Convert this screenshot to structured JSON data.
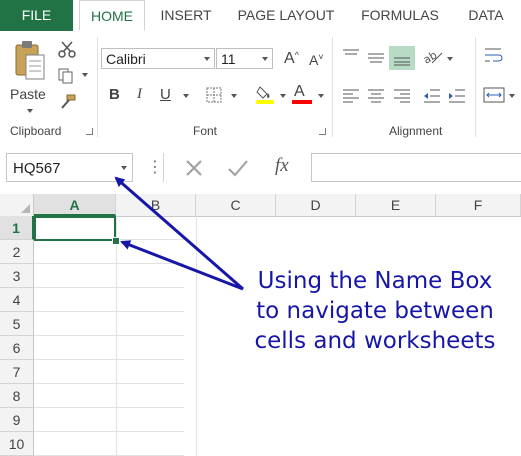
{
  "tabs": {
    "file": "FILE",
    "home": "HOME",
    "insert": "INSERT",
    "page_layout": "PAGE LAYOUT",
    "formulas": "FORMULAS",
    "data": "DATA"
  },
  "ribbon": {
    "clipboard": {
      "paste_label": "Paste",
      "group_label": "Clipboard"
    },
    "font": {
      "font_name": "Calibri",
      "font_size": "11",
      "bold": "B",
      "italic": "I",
      "underline": "U",
      "group_label": "Font",
      "fill_color": "#ffff00",
      "font_color": "#ff0000"
    },
    "alignment": {
      "group_label": "Alignment"
    }
  },
  "formula_bar": {
    "name_box_value": "HQ567",
    "fx_label": "fx"
  },
  "grid": {
    "columns": [
      "A",
      "B",
      "C",
      "D",
      "E",
      "F"
    ],
    "rows": [
      "1",
      "2",
      "3",
      "4",
      "5",
      "6",
      "7",
      "8",
      "9",
      "10"
    ],
    "active_column": "A",
    "active_row": "1"
  },
  "annotation": {
    "line1": "Using the Name Box",
    "line2": "to navigate between",
    "line3": "cells and worksheets",
    "color": "#1616a8"
  },
  "colors": {
    "accent": "#217346"
  }
}
